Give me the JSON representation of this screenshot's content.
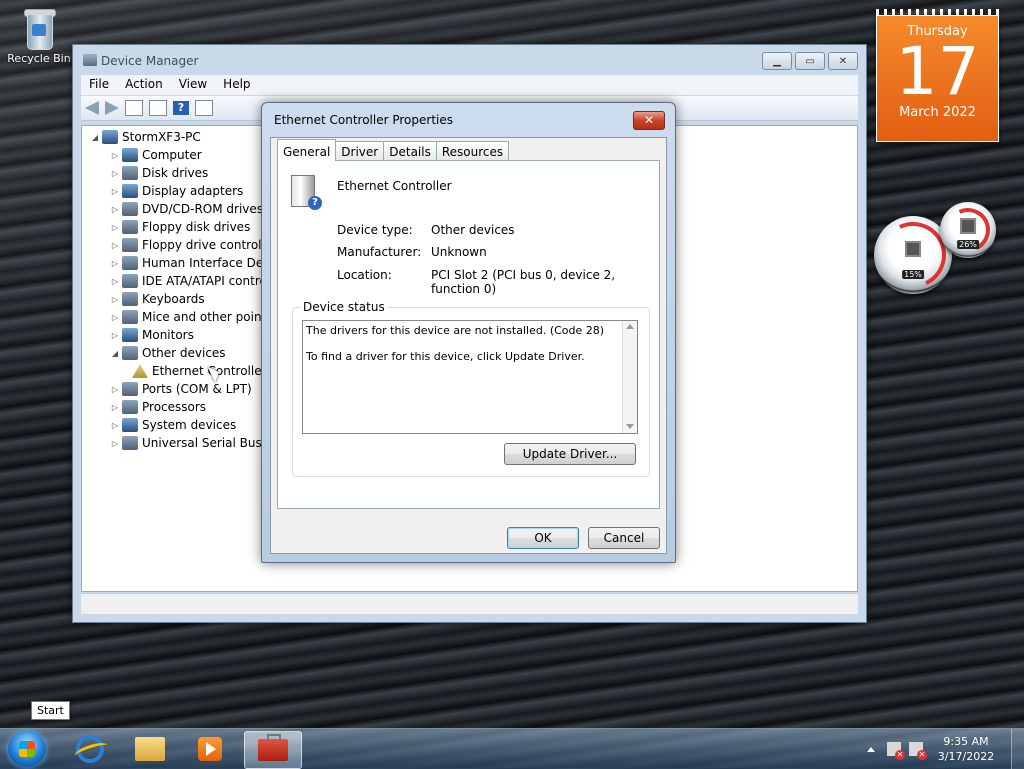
{
  "desktop": {
    "recycle_bin_label": "Recycle Bin"
  },
  "calendar": {
    "weekday": "Thursday",
    "day": "17",
    "month_year": "March 2022"
  },
  "cpu_meter": {
    "cpu_percent": "15%",
    "memory_percent": "26%"
  },
  "device_manager": {
    "title": "Device Manager",
    "menu": [
      "File",
      "Action",
      "View",
      "Help"
    ],
    "tree": {
      "root": "StormXF3-PC",
      "items": [
        "Computer",
        "Disk drives",
        "Display adapters",
        "DVD/CD-ROM drives",
        "Floppy disk drives",
        "Floppy drive controller",
        "Human Interface Devic",
        "IDE ATA/ATAPI contro",
        "Keyboards",
        "Mice and other pointin",
        "Monitors",
        "Other devices",
        "Ethernet Controller",
        "Ports (COM & LPT)",
        "Processors",
        "System devices",
        "Universal Serial Bus co"
      ]
    }
  },
  "dialog": {
    "title": "Ethernet Controller Properties",
    "tabs": [
      "General",
      "Driver",
      "Details",
      "Resources"
    ],
    "device_name": "Ethernet Controller",
    "device_type_label": "Device type:",
    "device_type_value": "Other devices",
    "manufacturer_label": "Manufacturer:",
    "manufacturer_value": "Unknown",
    "location_label": "Location:",
    "location_value": "PCI Slot 2 (PCI bus 0, device 2, function 0)",
    "status_group_label": "Device status",
    "status_line1": "The drivers for this device are not installed. (Code 28)",
    "status_line2": "To find a driver for this device, click Update Driver.",
    "update_driver_button": "Update Driver...",
    "ok_button": "OK",
    "cancel_button": "Cancel"
  },
  "taskbar": {
    "start_tooltip": "Start",
    "time": "9:35 AM",
    "date": "3/17/2022"
  }
}
